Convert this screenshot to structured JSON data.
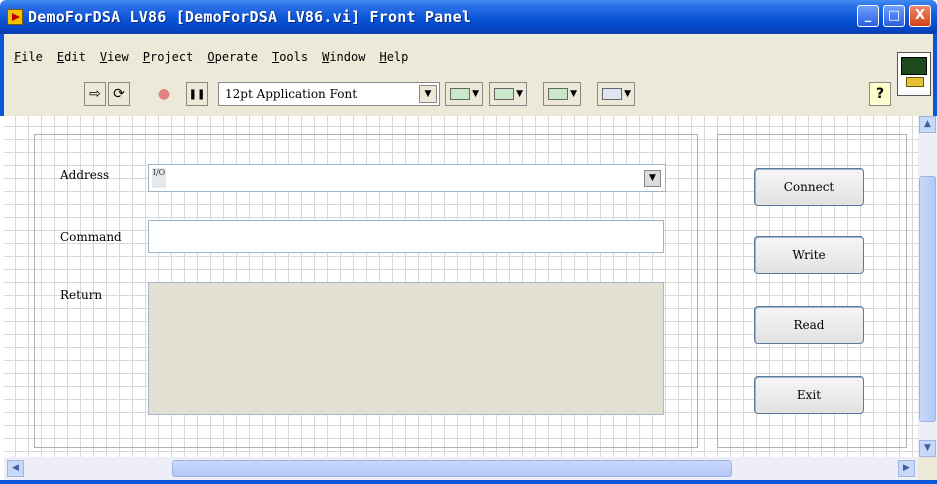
{
  "window": {
    "title": "DemoForDSA LV86 [DemoForDSA LV86.vi] Front Panel",
    "minimize_glyph": "_",
    "maximize_glyph": "□",
    "close_glyph": "X"
  },
  "menu": {
    "items": [
      "File",
      "Edit",
      "View",
      "Project",
      "Operate",
      "Tools",
      "Window",
      "Help"
    ]
  },
  "toolbar": {
    "run_glyph": "⇨",
    "run_continuous_glyph": "⟳",
    "abort_glyph": "●",
    "pause_glyph": "❚❚",
    "font_selector": "12pt Application Font",
    "dropdown_glyph": "▼",
    "help_glyph": "?"
  },
  "panel": {
    "address_label": "Address",
    "address_value": "",
    "address_icon_text": "I/O",
    "command_label": "Command",
    "command_value": "",
    "return_label": "Return",
    "return_value": "",
    "buttons": {
      "connect": "Connect",
      "write": "Write",
      "read": "Read",
      "exit": "Exit"
    }
  },
  "scroll": {
    "up_glyph": "▲",
    "down_glyph": "▼",
    "left_glyph": "◀",
    "right_glyph": "▶"
  },
  "colors": {
    "title_bar": "#0a55d8",
    "chrome": "#ece9d8",
    "indicator_bg": "#e2dfd3",
    "close_button": "#d0401a"
  }
}
